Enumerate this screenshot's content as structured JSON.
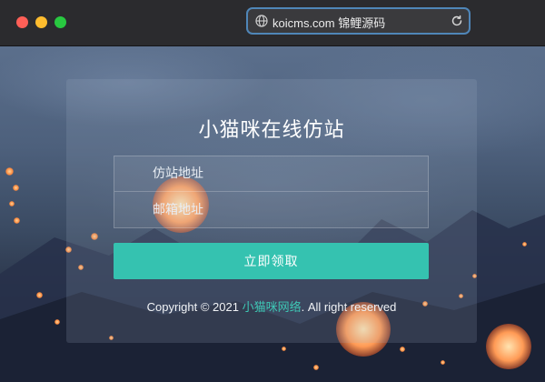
{
  "browser": {
    "url": "koicms.com 锦鲤源码"
  },
  "login": {
    "title": "小猫咪在线仿站",
    "site_placeholder": "仿站地址",
    "email_placeholder": "邮箱地址",
    "submit_label": "立即领取"
  },
  "footer": {
    "copyright_prefix": "Copyright © 2021",
    "brand": "小猫咪网络",
    "suffix": ". All right reserved"
  },
  "colors": {
    "accent": "#35c2b0",
    "brand_link": "#3ec7b5",
    "url_border": "#4f86b8"
  }
}
